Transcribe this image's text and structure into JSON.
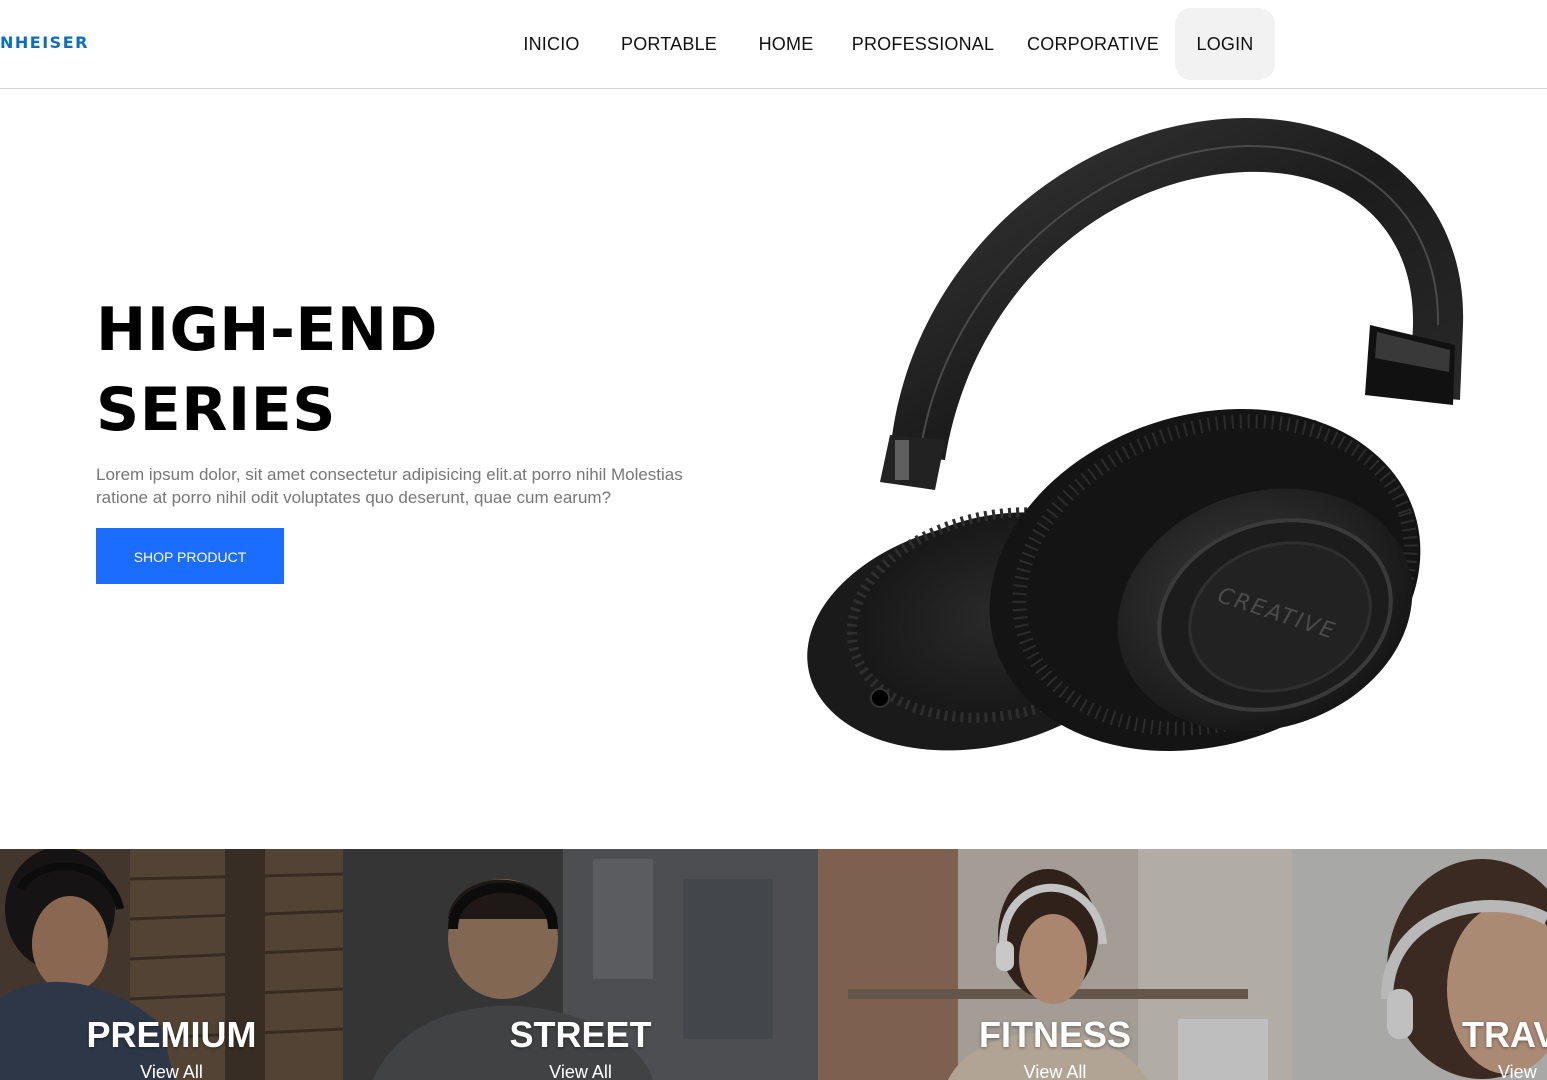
{
  "brand": {
    "logo_text": "NHEISER",
    "accent_color": "#0a6fc2"
  },
  "nav": {
    "items": [
      {
        "label": "INICIO"
      },
      {
        "label": "PORTABLE"
      },
      {
        "label": "HOME"
      },
      {
        "label": "PROFESSIONAL"
      },
      {
        "label": "CORPORATIVE"
      },
      {
        "label": "LOGIN"
      }
    ]
  },
  "hero": {
    "title_line1": "HIGH-END",
    "title_line2": "SERIES",
    "description": "Lorem ipsum dolor, sit amet consectetur adipisicing elit.at porro nihil Molestias ratione at porro nihil odit voluptates quo deserunt, quae cum earum?",
    "button_label": "SHOP PRODUCT",
    "button_color": "#1a6dff",
    "product_brand_text": "CREATIVE",
    "product_icon": "headphones-icon"
  },
  "categories": [
    {
      "title": "PREMIUM",
      "link_label": "View All"
    },
    {
      "title": "STREET",
      "link_label": "View All"
    },
    {
      "title": "FITNESS",
      "link_label": "View All"
    },
    {
      "title": "TRAV",
      "link_label": "View A"
    }
  ]
}
